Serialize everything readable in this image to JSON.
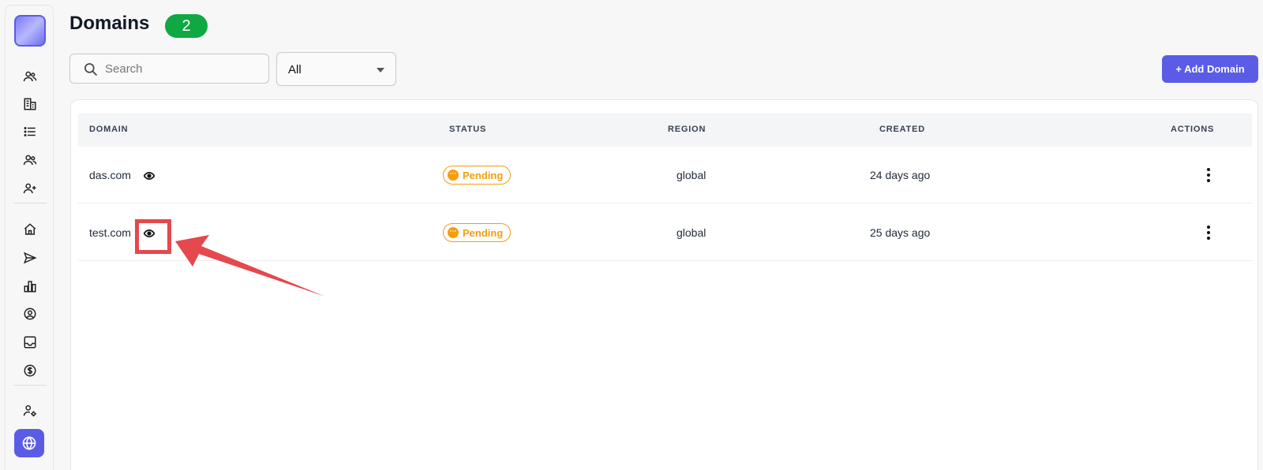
{
  "page": {
    "title": "Domains",
    "count": "2"
  },
  "toolbar": {
    "search_placeholder": "Search",
    "filter_value": "All",
    "add_label": "+ Add Domain"
  },
  "table": {
    "columns": [
      "DOMAIN",
      "STATUS",
      "REGION",
      "CREATED",
      "ACTIONS"
    ],
    "rows": [
      {
        "domain": "das.com",
        "status": "Pending",
        "region": "global",
        "created": "24 days ago"
      },
      {
        "domain": "test.com",
        "status": "Pending",
        "region": "global",
        "created": "25 days ago"
      }
    ]
  },
  "sidebar": {
    "icons": [
      "users-icon",
      "building-icon",
      "list-icon",
      "team-icon",
      "user-plus-icon",
      "home-icon",
      "send-icon",
      "chart-icon",
      "user-circle-icon",
      "inbox-icon",
      "dollar-icon",
      "user-settings-icon",
      "globe-icon"
    ],
    "active": "globe-icon"
  },
  "colors": {
    "accent": "#5b5ce6",
    "badge_green": "#10a843",
    "pending": "#f59e0b",
    "annotation_red": "#e5484d"
  }
}
